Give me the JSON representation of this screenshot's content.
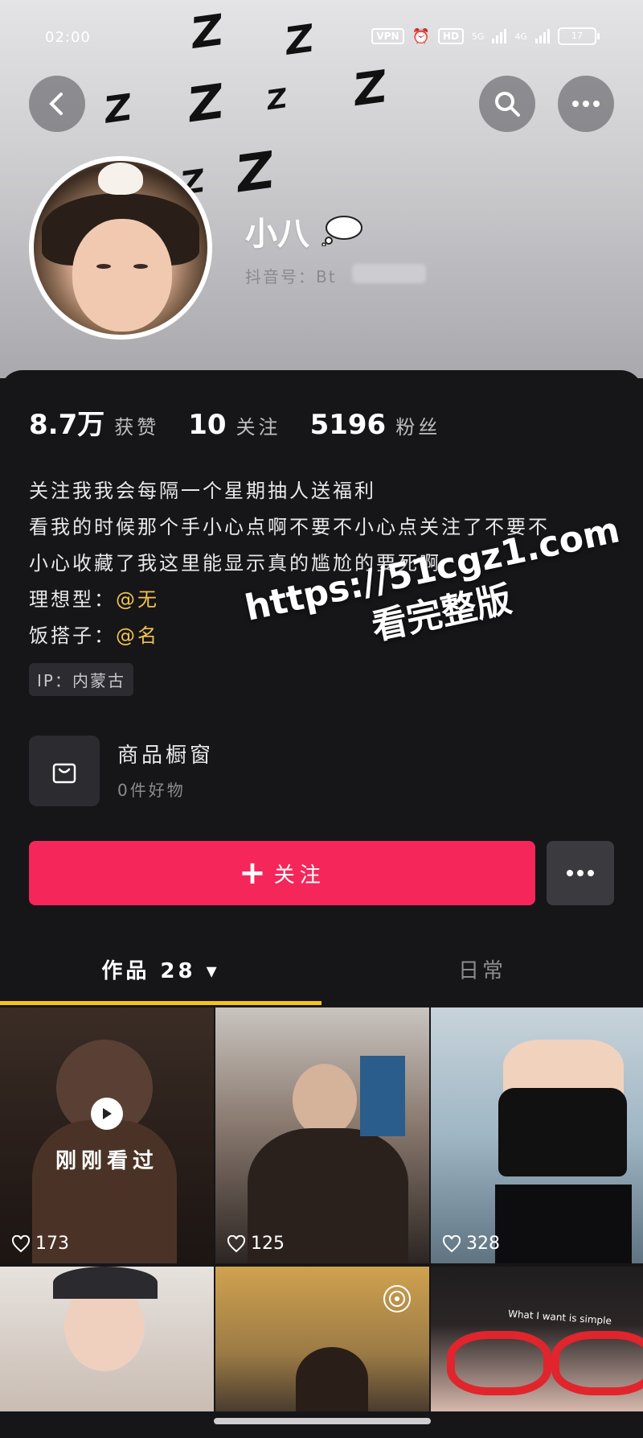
{
  "status_bar": {
    "time": "02:00",
    "vpn": "VPN",
    "hd": "HD",
    "net1": "5G",
    "net2": "4G",
    "battery": "17"
  },
  "profile": {
    "nickname": "小八",
    "douyin_id_label": "抖音号：Bt"
  },
  "stats": [
    {
      "value": "8.7万",
      "label": "获赞"
    },
    {
      "value": "10",
      "label": "关注"
    },
    {
      "value": "5196",
      "label": "粉丝"
    }
  ],
  "bio": {
    "line1": "关注我我会每隔一个星期抽人送福利",
    "line2": "看我的时候那个手小心点啊不要不小心点关注了不要不",
    "line3": "小心收藏了我这里能显示真的尴尬的要死啊",
    "line4_label": "理想型：",
    "line4_value": "@无",
    "line5_label": "饭搭子：",
    "line5_value": "@名"
  },
  "ip_tag": "IP：内蒙古",
  "shop": {
    "title": "商品橱窗",
    "subtitle": "0件好物"
  },
  "follow_button": {
    "plus": "+",
    "label": "关注"
  },
  "tabs": [
    {
      "label": "作品 28 ▾"
    },
    {
      "label": "日常"
    }
  ],
  "watched_label": "刚刚看过",
  "videos": [
    {
      "likes": "173"
    },
    {
      "likes": "125"
    },
    {
      "likes": "328"
    }
  ],
  "watermark": {
    "line1": "https://51cgz1.com",
    "line2": "看完整版"
  },
  "tile_caption": "What I want is simple",
  "colors": {
    "accent_red": "#f5265a",
    "tab_underline": "#f7c21d",
    "mention": "#f0c24e"
  }
}
